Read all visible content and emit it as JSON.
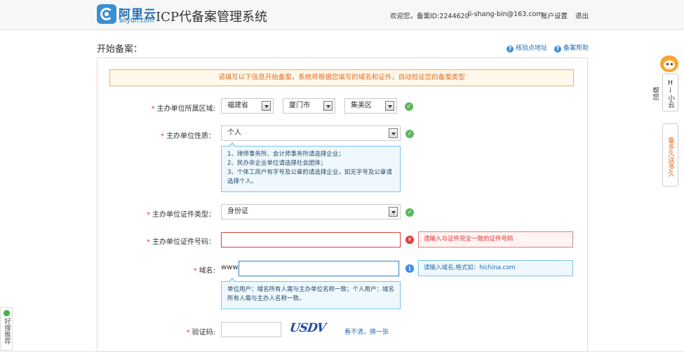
{
  "header": {
    "logo_cn": "阿里云",
    "logo_en": "aliyun.com",
    "system_title": "ICP代备案管理系统",
    "welcome": "欢迎您，备案ID:2244620",
    "user_email": "li-shang-bin@163.com",
    "account_settings": "账户设置",
    "logout": "退出"
  },
  "page": {
    "title": "开始备案：",
    "verify_address_link": "核验点地址",
    "help_link": "备案帮助"
  },
  "notice": "请填写以下信息开始备案，系统将根据您填写的域名和证件，自动验证您的备案类型",
  "form": {
    "region": {
      "label": "主办单位所属区域:",
      "province": "福建省",
      "city": "厦门市",
      "district": "集美区"
    },
    "nature": {
      "label": "主办单位性质：",
      "value": "个人",
      "tip_lines": [
        "1、律师事务所、会计师事务所请选择企业；",
        "2、民办非企业单位请选择社会团体；",
        "3、个体工商户有字号及公章的请选择企业，如无字号及公章请",
        "选择个人。"
      ]
    },
    "id_type": {
      "label": "主办单位证件类型：",
      "value": "身份证"
    },
    "id_number": {
      "label": "主办单位证件号码：",
      "value": "",
      "error": "请输入与证件完全一致的证件号码"
    },
    "domain": {
      "label": "域名:",
      "prefix": "www.",
      "value": "",
      "hint": "请输入域名,格式如：hichina.com",
      "tip_lines": [
        "单位用户：域名所有人需与主办单位名称一致；个人用户：域名",
        "所有人需与主办人名称一致。"
      ]
    },
    "captcha": {
      "label": "验证码:",
      "value": "",
      "image_text": "USDV",
      "refresh_link": "看不清，换一张"
    },
    "required_mark": "*"
  },
  "sidebar": {
    "hi_widget": "Hi小云帮您",
    "feedback_widget": "备多久送多久",
    "good_widget": "好搜推荐"
  },
  "colors": {
    "brand_blue": "#1f6fb5",
    "notice_orange": "#e46b1e",
    "error_red": "#e0403b",
    "success_green": "#5cb85c",
    "info_blue": "#3a8ee6"
  }
}
